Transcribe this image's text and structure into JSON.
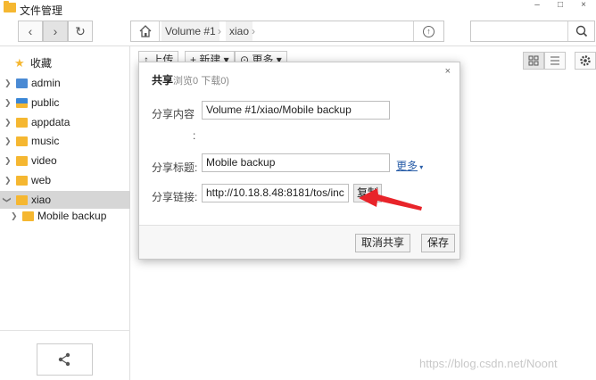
{
  "window": {
    "title": "文件管理",
    "minimize": "–",
    "maximize": "□",
    "close": "×"
  },
  "toolbar": {
    "back_glyph": "‹",
    "forward_glyph": "›",
    "refresh_glyph": "↻",
    "breadcrumbs": [
      "Volume #1",
      "xiao"
    ],
    "up_glyph": "↑"
  },
  "search": {
    "value": "",
    "placeholder": ""
  },
  "sidebar": {
    "favorites": "收藏",
    "items": [
      {
        "label": "admin",
        "icon": "user-folder-icon"
      },
      {
        "label": "public",
        "icon": "public-folder-icon"
      },
      {
        "label": "appdata",
        "icon": "folder-icon"
      },
      {
        "label": "music",
        "icon": "folder-icon"
      },
      {
        "label": "video",
        "icon": "folder-icon"
      },
      {
        "label": "web",
        "icon": "folder-icon"
      },
      {
        "label": "xiao",
        "icon": "folder-icon",
        "expanded": true,
        "selected": true
      },
      {
        "label": "Mobile backup",
        "icon": "folder-icon",
        "child": true
      }
    ]
  },
  "subtoolbar": {
    "upload": "↑ 上传",
    "new": "+ 新建 ▾",
    "more": "⊙ 更多 ▾"
  },
  "dialog": {
    "title": "共享",
    "subtitle": "浏览0 下载0)",
    "close": "×",
    "content_label": "分享内容",
    "content_colon": ":",
    "content_value": "Volume #1/xiao/Mobile backup",
    "title_label": "分享标题:",
    "title_value": "Mobile backup",
    "more": "更多",
    "link_label": "分享链接:",
    "link_value": "http://10.18.8.48:8181/tos/inc",
    "copy": "复制",
    "cancel_share": "取消共享",
    "save": "保存"
  },
  "watermark": "https://blog.csdn.net/Noont",
  "colors": {
    "folder": "#f5b731",
    "selected": "#d6d6d6",
    "annotation_arrow": "#e8242a",
    "link": "#2a5ea8"
  }
}
